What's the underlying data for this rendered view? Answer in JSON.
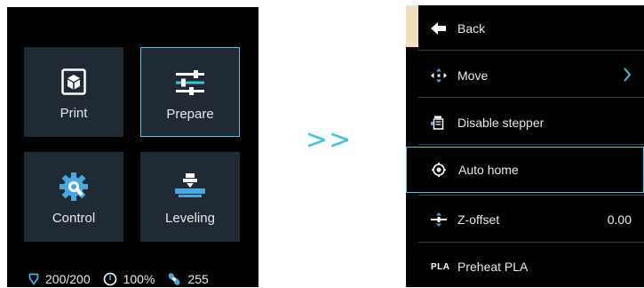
{
  "main_menu": {
    "tiles": [
      {
        "label": "Print",
        "icon": "print-cube-icon"
      },
      {
        "label": "Prepare",
        "icon": "sliders-icon"
      },
      {
        "label": "Control",
        "icon": "gear-wrench-icon"
      },
      {
        "label": "Leveling",
        "icon": "bed-leveling-icon"
      }
    ],
    "selected_tile": "Prepare",
    "status": {
      "temperature": "200/200",
      "speed": "100%",
      "fan": "255"
    }
  },
  "transition_arrows": ">>",
  "prepare_menu": {
    "items": [
      {
        "label": "Back",
        "icon": "back-arrow-icon"
      },
      {
        "label": "Move",
        "icon": "move-arrows-icon",
        "has_submenu": true
      },
      {
        "label": "Disable stepper",
        "icon": "stepper-icon"
      },
      {
        "label": "Auto home",
        "icon": "home-target-icon"
      },
      {
        "label": "Z-offset",
        "icon": "z-offset-icon",
        "value": "0.00"
      },
      {
        "label": "Preheat PLA",
        "icon": "pla-icon"
      }
    ],
    "selected_item": "Auto home",
    "pla_icon_text": "PLA"
  },
  "colors": {
    "accent": "#4ac8e0",
    "tile_bg": "#1f2a35",
    "screen_bg": "#000000",
    "back_highlight": "#f1dfbd"
  }
}
